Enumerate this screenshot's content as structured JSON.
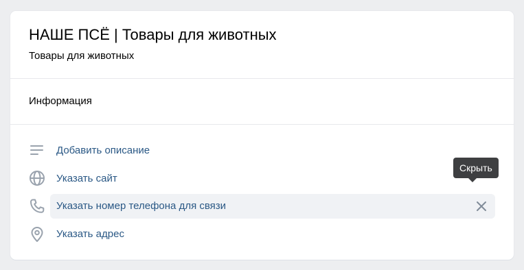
{
  "header": {
    "title": "НАШЕ ПСЁ | Товары для животных",
    "subtitle": "Товары для животных"
  },
  "info_section": {
    "title": "Информация",
    "items": [
      {
        "label": "Добавить описание",
        "icon": "text-lines-icon"
      },
      {
        "label": "Указать сайт",
        "icon": "globe-icon"
      },
      {
        "label": "Указать номер телефона для связи",
        "icon": "phone-icon"
      },
      {
        "label": "Указать адрес",
        "icon": "location-pin-icon"
      }
    ]
  },
  "tooltip": {
    "text": "Скрыть"
  },
  "colors": {
    "link": "#2a5885",
    "icon": "#99a2ad",
    "tooltip_bg": "#3e3f41",
    "hover_bg": "#f0f2f5"
  }
}
